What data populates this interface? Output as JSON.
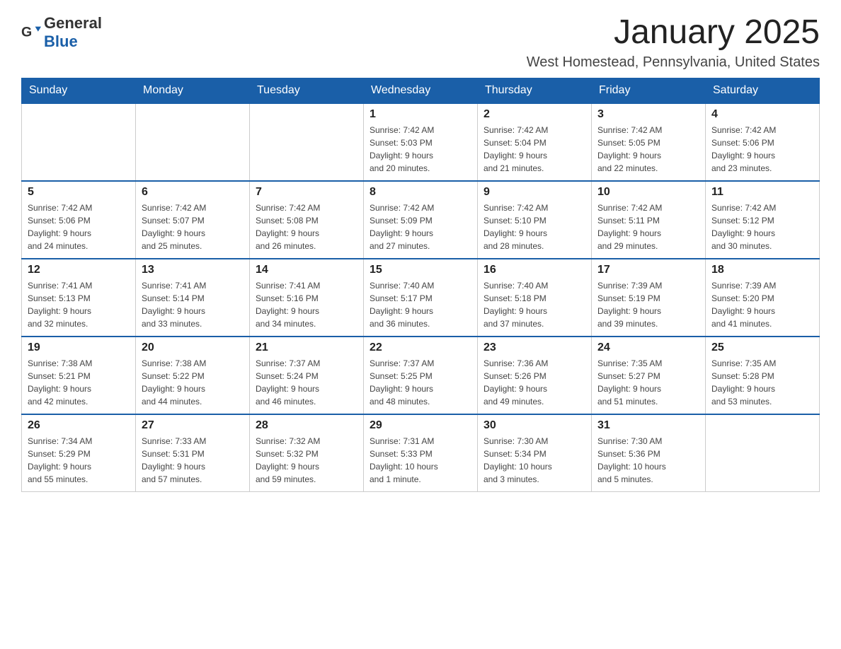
{
  "header": {
    "logo": {
      "text_general": "General",
      "text_blue": "Blue"
    },
    "month_title": "January 2025",
    "location": "West Homestead, Pennsylvania, United States"
  },
  "weekdays": [
    "Sunday",
    "Monday",
    "Tuesday",
    "Wednesday",
    "Thursday",
    "Friday",
    "Saturday"
  ],
  "weeks": [
    [
      {
        "day": "",
        "info": ""
      },
      {
        "day": "",
        "info": ""
      },
      {
        "day": "",
        "info": ""
      },
      {
        "day": "1",
        "info": "Sunrise: 7:42 AM\nSunset: 5:03 PM\nDaylight: 9 hours\nand 20 minutes."
      },
      {
        "day": "2",
        "info": "Sunrise: 7:42 AM\nSunset: 5:04 PM\nDaylight: 9 hours\nand 21 minutes."
      },
      {
        "day": "3",
        "info": "Sunrise: 7:42 AM\nSunset: 5:05 PM\nDaylight: 9 hours\nand 22 minutes."
      },
      {
        "day": "4",
        "info": "Sunrise: 7:42 AM\nSunset: 5:06 PM\nDaylight: 9 hours\nand 23 minutes."
      }
    ],
    [
      {
        "day": "5",
        "info": "Sunrise: 7:42 AM\nSunset: 5:06 PM\nDaylight: 9 hours\nand 24 minutes."
      },
      {
        "day": "6",
        "info": "Sunrise: 7:42 AM\nSunset: 5:07 PM\nDaylight: 9 hours\nand 25 minutes."
      },
      {
        "day": "7",
        "info": "Sunrise: 7:42 AM\nSunset: 5:08 PM\nDaylight: 9 hours\nand 26 minutes."
      },
      {
        "day": "8",
        "info": "Sunrise: 7:42 AM\nSunset: 5:09 PM\nDaylight: 9 hours\nand 27 minutes."
      },
      {
        "day": "9",
        "info": "Sunrise: 7:42 AM\nSunset: 5:10 PM\nDaylight: 9 hours\nand 28 minutes."
      },
      {
        "day": "10",
        "info": "Sunrise: 7:42 AM\nSunset: 5:11 PM\nDaylight: 9 hours\nand 29 minutes."
      },
      {
        "day": "11",
        "info": "Sunrise: 7:42 AM\nSunset: 5:12 PM\nDaylight: 9 hours\nand 30 minutes."
      }
    ],
    [
      {
        "day": "12",
        "info": "Sunrise: 7:41 AM\nSunset: 5:13 PM\nDaylight: 9 hours\nand 32 minutes."
      },
      {
        "day": "13",
        "info": "Sunrise: 7:41 AM\nSunset: 5:14 PM\nDaylight: 9 hours\nand 33 minutes."
      },
      {
        "day": "14",
        "info": "Sunrise: 7:41 AM\nSunset: 5:16 PM\nDaylight: 9 hours\nand 34 minutes."
      },
      {
        "day": "15",
        "info": "Sunrise: 7:40 AM\nSunset: 5:17 PM\nDaylight: 9 hours\nand 36 minutes."
      },
      {
        "day": "16",
        "info": "Sunrise: 7:40 AM\nSunset: 5:18 PM\nDaylight: 9 hours\nand 37 minutes."
      },
      {
        "day": "17",
        "info": "Sunrise: 7:39 AM\nSunset: 5:19 PM\nDaylight: 9 hours\nand 39 minutes."
      },
      {
        "day": "18",
        "info": "Sunrise: 7:39 AM\nSunset: 5:20 PM\nDaylight: 9 hours\nand 41 minutes."
      }
    ],
    [
      {
        "day": "19",
        "info": "Sunrise: 7:38 AM\nSunset: 5:21 PM\nDaylight: 9 hours\nand 42 minutes."
      },
      {
        "day": "20",
        "info": "Sunrise: 7:38 AM\nSunset: 5:22 PM\nDaylight: 9 hours\nand 44 minutes."
      },
      {
        "day": "21",
        "info": "Sunrise: 7:37 AM\nSunset: 5:24 PM\nDaylight: 9 hours\nand 46 minutes."
      },
      {
        "day": "22",
        "info": "Sunrise: 7:37 AM\nSunset: 5:25 PM\nDaylight: 9 hours\nand 48 minutes."
      },
      {
        "day": "23",
        "info": "Sunrise: 7:36 AM\nSunset: 5:26 PM\nDaylight: 9 hours\nand 49 minutes."
      },
      {
        "day": "24",
        "info": "Sunrise: 7:35 AM\nSunset: 5:27 PM\nDaylight: 9 hours\nand 51 minutes."
      },
      {
        "day": "25",
        "info": "Sunrise: 7:35 AM\nSunset: 5:28 PM\nDaylight: 9 hours\nand 53 minutes."
      }
    ],
    [
      {
        "day": "26",
        "info": "Sunrise: 7:34 AM\nSunset: 5:29 PM\nDaylight: 9 hours\nand 55 minutes."
      },
      {
        "day": "27",
        "info": "Sunrise: 7:33 AM\nSunset: 5:31 PM\nDaylight: 9 hours\nand 57 minutes."
      },
      {
        "day": "28",
        "info": "Sunrise: 7:32 AM\nSunset: 5:32 PM\nDaylight: 9 hours\nand 59 minutes."
      },
      {
        "day": "29",
        "info": "Sunrise: 7:31 AM\nSunset: 5:33 PM\nDaylight: 10 hours\nand 1 minute."
      },
      {
        "day": "30",
        "info": "Sunrise: 7:30 AM\nSunset: 5:34 PM\nDaylight: 10 hours\nand 3 minutes."
      },
      {
        "day": "31",
        "info": "Sunrise: 7:30 AM\nSunset: 5:36 PM\nDaylight: 10 hours\nand 5 minutes."
      },
      {
        "day": "",
        "info": ""
      }
    ]
  ]
}
